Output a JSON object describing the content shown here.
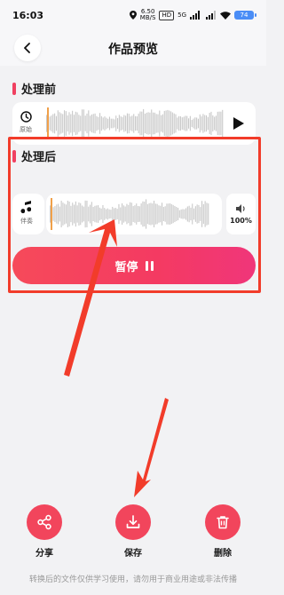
{
  "status_bar": {
    "time": "16:03",
    "speed_value": "6.50",
    "speed_unit": "MB/S",
    "hd_label": "HD",
    "network_label": "5G",
    "battery": "74"
  },
  "nav": {
    "title": "作品预览"
  },
  "before": {
    "title": "处理前",
    "track_label": "原始"
  },
  "after": {
    "title": "处理后",
    "track_label": "伴奏",
    "volume": "100%",
    "pause_label": "暂停"
  },
  "actions": {
    "share": "分享",
    "save": "保存",
    "delete": "删除"
  },
  "footer": {
    "note": "转换后的文件仅供学习使用，请勿用于商业用途或非法传播"
  },
  "colors": {
    "accent": "#f2455c",
    "annotation_red": "#f23c2a"
  }
}
